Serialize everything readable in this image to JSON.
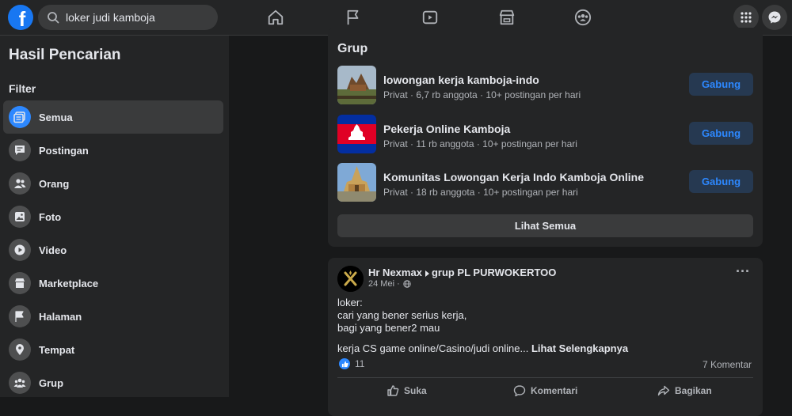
{
  "topbar": {
    "search_value": "loker judi kamboja"
  },
  "sidebar": {
    "title": "Hasil Pencarian",
    "filter_label": "Filter",
    "items": [
      {
        "label": "Semua",
        "icon": "all-results-icon"
      },
      {
        "label": "Postingan",
        "icon": "posts-icon"
      },
      {
        "label": "Orang",
        "icon": "people-icon"
      },
      {
        "label": "Foto",
        "icon": "photo-icon"
      },
      {
        "label": "Video",
        "icon": "video-icon"
      },
      {
        "label": "Marketplace",
        "icon": "marketplace-icon"
      },
      {
        "label": "Halaman",
        "icon": "flag-icon"
      },
      {
        "label": "Tempat",
        "icon": "location-icon"
      },
      {
        "label": "Grup",
        "icon": "groups-icon"
      }
    ]
  },
  "groups": {
    "title": "Grup",
    "join_label": "Gabung",
    "see_all_label": "Lihat Semua",
    "items": [
      {
        "name": "lowongan kerja kamboja-indo",
        "meta": "Privat · 6,7 rb anggota · 10+ postingan per hari"
      },
      {
        "name": "Pekerja Online Kamboja",
        "meta": "Privat · 11 rb anggota · 10+ postingan per hari"
      },
      {
        "name": "Komunitas Lowongan Kerja Indo Kamboja Online",
        "meta": "Privat · 18 rb anggota · 10+ postingan per hari"
      }
    ]
  },
  "post": {
    "author": "Hr Nexmax",
    "group": "grup PL PURWOKERTOO",
    "date": "24 Mei ·",
    "line1": "loker:",
    "line2": "cari yang bener serius kerja,",
    "line3": "bagi yang bener2 mau",
    "line4": "kerja CS game online/Casino/judi online...",
    "see_more": "Lihat Selengkapnya",
    "like_count": "11",
    "comments": "7 Komentar",
    "like_label": "Suka",
    "comment_label": "Komentari",
    "share_label": "Bagikan"
  },
  "colors": {
    "accent": "#2d88ff",
    "background": "#18191a",
    "surface": "#242526"
  }
}
